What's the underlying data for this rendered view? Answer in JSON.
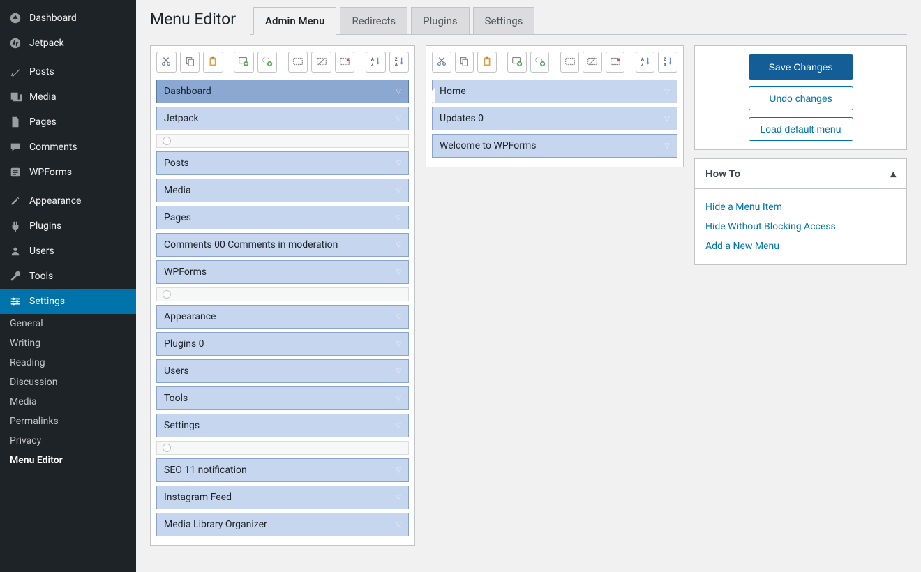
{
  "sidebar": {
    "items": [
      {
        "label": "Dashboard",
        "icon": "dashboard"
      },
      {
        "label": "Jetpack",
        "icon": "jetpack"
      },
      {
        "label": "Posts",
        "icon": "pin"
      },
      {
        "label": "Media",
        "icon": "media"
      },
      {
        "label": "Pages",
        "icon": "pages"
      },
      {
        "label": "Comments",
        "icon": "comments"
      },
      {
        "label": "WPForms",
        "icon": "forms"
      },
      {
        "label": "Appearance",
        "icon": "appearance"
      },
      {
        "label": "Plugins",
        "icon": "plugins"
      },
      {
        "label": "Users",
        "icon": "users"
      },
      {
        "label": "Tools",
        "icon": "tools"
      },
      {
        "label": "Settings",
        "icon": "settings",
        "active": true
      }
    ],
    "subitems": [
      {
        "label": "General"
      },
      {
        "label": "Writing"
      },
      {
        "label": "Reading"
      },
      {
        "label": "Discussion"
      },
      {
        "label": "Media"
      },
      {
        "label": "Permalinks"
      },
      {
        "label": "Privacy"
      },
      {
        "label": "Menu Editor",
        "current": true
      }
    ]
  },
  "page": {
    "title": "Menu Editor",
    "tabs": [
      "Admin Menu",
      "Redirects",
      "Plugins",
      "Settings"
    ],
    "active_tab": 0
  },
  "toolbar_semantic": [
    "cut",
    "copy",
    "paste",
    "add",
    "add-sep",
    "hide",
    "show",
    "delete",
    "sort-az",
    "sort-za"
  ],
  "main_menu": [
    {
      "label": "Dashboard",
      "selected": true
    },
    {
      "label": "Jetpack"
    },
    {
      "type": "sep"
    },
    {
      "label": "Posts"
    },
    {
      "label": "Media"
    },
    {
      "label": "Pages"
    },
    {
      "label": "Comments 00 Comments in moderation"
    },
    {
      "label": "WPForms"
    },
    {
      "type": "sep"
    },
    {
      "label": "Appearance"
    },
    {
      "label": "Plugins 0"
    },
    {
      "label": "Users"
    },
    {
      "label": "Tools"
    },
    {
      "label": "Settings"
    },
    {
      "type": "sep"
    },
    {
      "label": "SEO 11 notification"
    },
    {
      "label": "Instagram Feed"
    },
    {
      "label": "Media Library Organizer"
    }
  ],
  "sub_menu": [
    {
      "label": "Home"
    },
    {
      "label": "Updates 0"
    },
    {
      "label": "Welcome to WPForms"
    }
  ],
  "buttons": {
    "save": "Save Changes",
    "undo": "Undo changes",
    "load_default": "Load default menu"
  },
  "howto": {
    "title": "How To",
    "links": [
      "Hide a Menu Item",
      "Hide Without Blocking Access",
      "Add a New Menu"
    ]
  }
}
